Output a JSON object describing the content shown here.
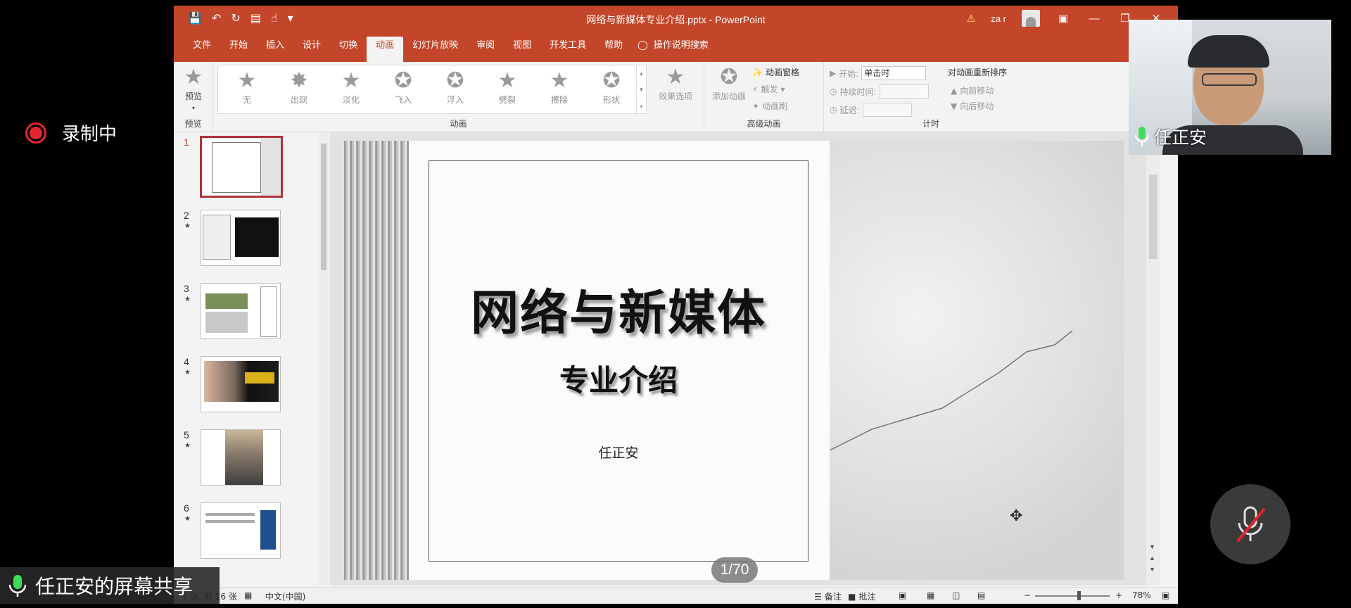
{
  "overlay": {
    "recording_label": "录制中",
    "share_label": "任正安的屏幕共享",
    "webcam_name": "任正安"
  },
  "window": {
    "title": "网络与新媒体专业介绍.pptx - PowerPoint",
    "user": "za r"
  },
  "tabs": [
    {
      "label": "文件"
    },
    {
      "label": "开始"
    },
    {
      "label": "插入"
    },
    {
      "label": "设计"
    },
    {
      "label": "切换"
    },
    {
      "label": "动画"
    },
    {
      "label": "幻灯片放映"
    },
    {
      "label": "审阅"
    },
    {
      "label": "视图"
    },
    {
      "label": "开发工具"
    },
    {
      "label": "帮助"
    }
  ],
  "tell_me": "操作说明搜索",
  "ribbon": {
    "preview": {
      "button": "预览",
      "group": "预览"
    },
    "animation": {
      "group": "动画",
      "items": [
        "无",
        "出现",
        "淡化",
        "飞入",
        "浮入",
        "劈裂",
        "擦除",
        "形状"
      ],
      "effect_options": "效果选项"
    },
    "advanced": {
      "group": "高级动画",
      "add_animation": "添加动画",
      "pane": "动画窗格",
      "trigger": "触发",
      "painter": "动画刷"
    },
    "timing": {
      "group": "计时",
      "start_label": "开始:",
      "start_value": "单击时",
      "duration_label": "持续时间:",
      "delay_label": "延迟:",
      "reorder_title": "对动画重新排序",
      "move_earlier": "向前移动",
      "move_later": "向后移动"
    }
  },
  "thumbnails": [
    {
      "num": "1",
      "star": ""
    },
    {
      "num": "2",
      "star": "★"
    },
    {
      "num": "3",
      "star": "★"
    },
    {
      "num": "4",
      "star": "★"
    },
    {
      "num": "5",
      "star": "★"
    },
    {
      "num": "6",
      "star": "★"
    }
  ],
  "slide": {
    "title": "网络与新媒体",
    "subtitle": "专业介绍",
    "author": "任正安",
    "page_indicator": "1/70"
  },
  "statusbar": {
    "slide_info": "1 张, 共 16 张",
    "language": "中文(中国)",
    "notes": "备注",
    "comments": "批注",
    "zoom": "78%"
  },
  "colors": {
    "accent": "#c4462a",
    "recording": "#e3262d"
  }
}
